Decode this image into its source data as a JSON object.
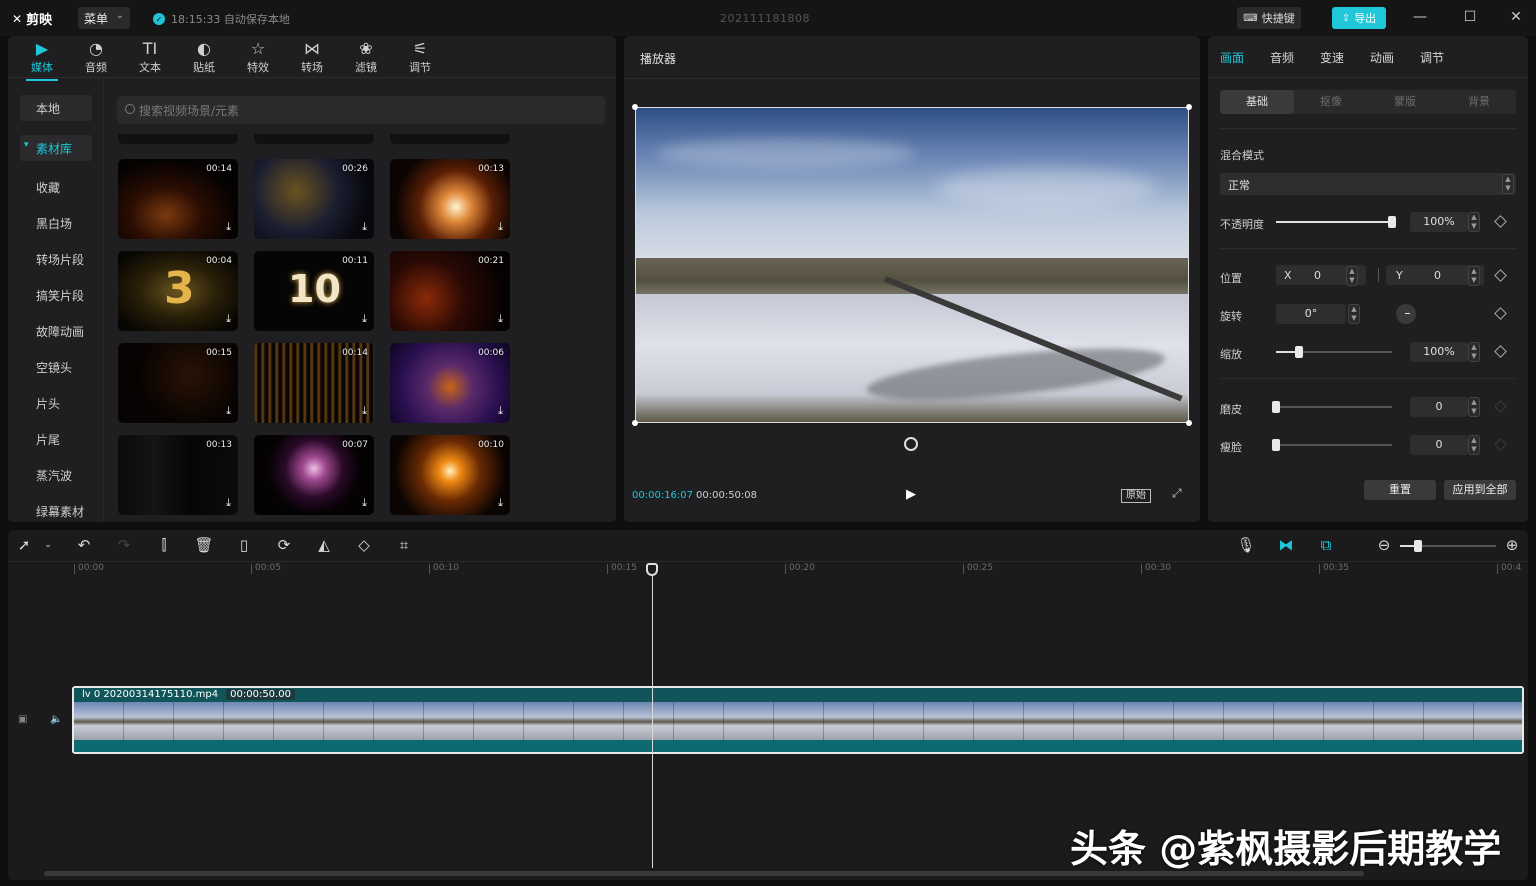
{
  "titlebar": {
    "app_name": "剪映",
    "menu_label": "菜单",
    "autosave": "18:15:33 自动保存本地",
    "project_title": "202111181808",
    "shortcut_label": "快捷键",
    "export_label": "导出"
  },
  "media": {
    "tabs": [
      {
        "label": "媒体",
        "icon": "media-icon"
      },
      {
        "label": "音频",
        "icon": "audio-icon"
      },
      {
        "label": "文本",
        "icon": "text-icon"
      },
      {
        "label": "贴纸",
        "icon": "sticker-icon"
      },
      {
        "label": "特效",
        "icon": "effects-icon"
      },
      {
        "label": "转场",
        "icon": "transition-icon"
      },
      {
        "label": "滤镜",
        "icon": "filter-icon"
      },
      {
        "label": "调节",
        "icon": "adjust-icon"
      }
    ],
    "sidebar": {
      "local": "本地",
      "library": "素材库",
      "categories": [
        "收藏",
        "黑白场",
        "转场片段",
        "搞笑片段",
        "故障动画",
        "空镜头",
        "片头",
        "片尾",
        "蒸汽波",
        "绿幕素材"
      ]
    },
    "search_placeholder": "搜索视频场景/元素",
    "thumbnails": [
      {
        "duration": "00:14"
      },
      {
        "duration": "00:26"
      },
      {
        "duration": "00:13"
      },
      {
        "duration": "00:04",
        "big_text": "3"
      },
      {
        "duration": "00:11",
        "big_text": "10"
      },
      {
        "duration": "00:21"
      },
      {
        "duration": "00:15"
      },
      {
        "duration": "00:14"
      },
      {
        "duration": "00:06"
      },
      {
        "duration": "00:13"
      },
      {
        "duration": "00:07"
      },
      {
        "duration": "00:10"
      }
    ]
  },
  "player": {
    "title": "播放器",
    "current_time": "00:00:16:07",
    "total_time": "00:00:50:08",
    "original_label": "原始"
  },
  "props": {
    "tabs": [
      "画面",
      "音频",
      "变速",
      "动画",
      "调节"
    ],
    "subtabs": [
      "基础",
      "抠像",
      "蒙版",
      "背景"
    ],
    "blend_label": "混合模式",
    "blend_value": "正常",
    "opacity_label": "不透明度",
    "opacity_value": "100%",
    "position_label": "位置",
    "x_label": "X",
    "x_value": "0",
    "y_label": "Y",
    "y_value": "0",
    "rotation_label": "旋转",
    "rotation_value": "0°",
    "scale_label": "缩放",
    "scale_value": "100%",
    "smooth_label": "磨皮",
    "smooth_value": "0",
    "slim_label": "瘦脸",
    "slim_value": "0",
    "reset_label": "重置",
    "apply_all_label": "应用到全部",
    "opacity_level": 1.0,
    "scale_level": 0.2,
    "smooth_level": 0,
    "slim_level": 0
  },
  "timeline": {
    "ruler": [
      "00:00",
      "00:05",
      "00:10",
      "00:15",
      "00:20",
      "00:25",
      "00:30",
      "00:35",
      "00:4"
    ],
    "clip_name": "lv 0 20200314175110.mp4",
    "clip_duration": "00:00:50.00"
  },
  "watermark": "头条 @紫枫摄影后期教学",
  "colors": {
    "accent": "#1fc7d8",
    "panel": "#1f1f21",
    "background": "#0f0f10"
  }
}
